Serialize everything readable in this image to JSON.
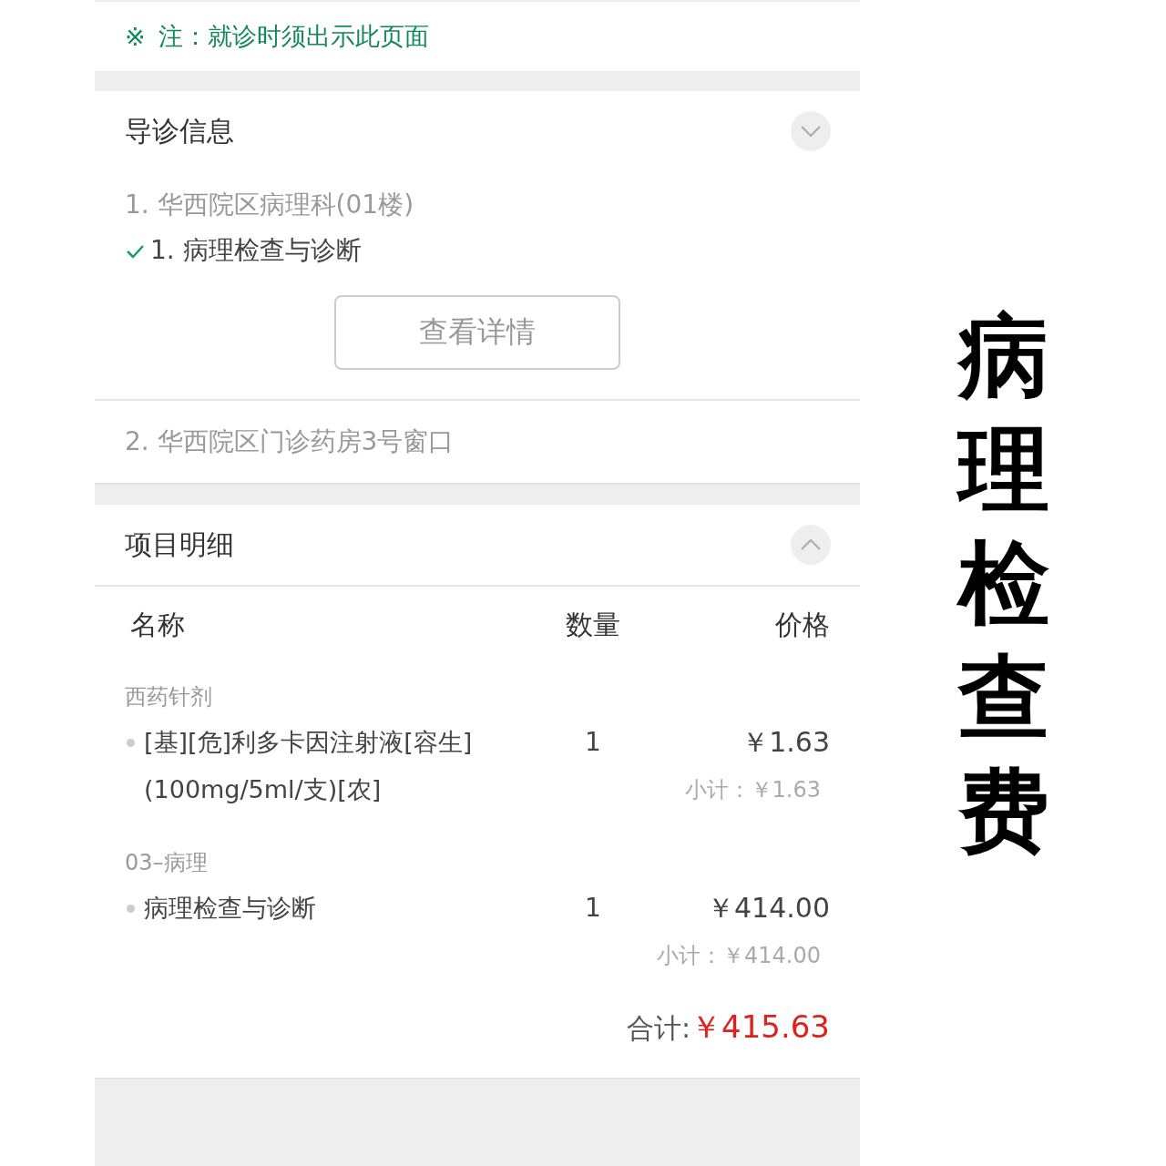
{
  "notice": {
    "mark": "※",
    "text": "注：就诊时须出示此页面"
  },
  "guide": {
    "title": "导诊信息",
    "expanded": false,
    "steps": [
      {
        "text": "1. 华西院区病理科(01楼)",
        "children": [
          {
            "text": "1. 病理检查与诊断",
            "checked": true
          }
        ]
      },
      {
        "text": "2. 华西院区门诊药房3号窗口"
      }
    ],
    "button": "查看详情"
  },
  "items": {
    "title": "项目明细",
    "expanded": true,
    "columns": [
      "名称",
      "数量",
      "价格"
    ],
    "groups": [
      {
        "name": "西药针剂",
        "rows": [
          {
            "name": "[基][危]利多卡因注射液[容生](100mg/5ml/支)[农]",
            "quantity": "1",
            "price": "￥1.63",
            "subtotal_label": "小计：",
            "subtotal": "￥1.63"
          }
        ]
      },
      {
        "name": "03–病理",
        "rows": [
          {
            "name": "病理检查与诊断",
            "quantity": "1",
            "price": "￥414.00",
            "subtotal_label": "小计：",
            "subtotal": "￥414.00"
          }
        ]
      }
    ],
    "total_label": "合计:",
    "total": "￥415.63"
  },
  "banner": "病理检查费"
}
